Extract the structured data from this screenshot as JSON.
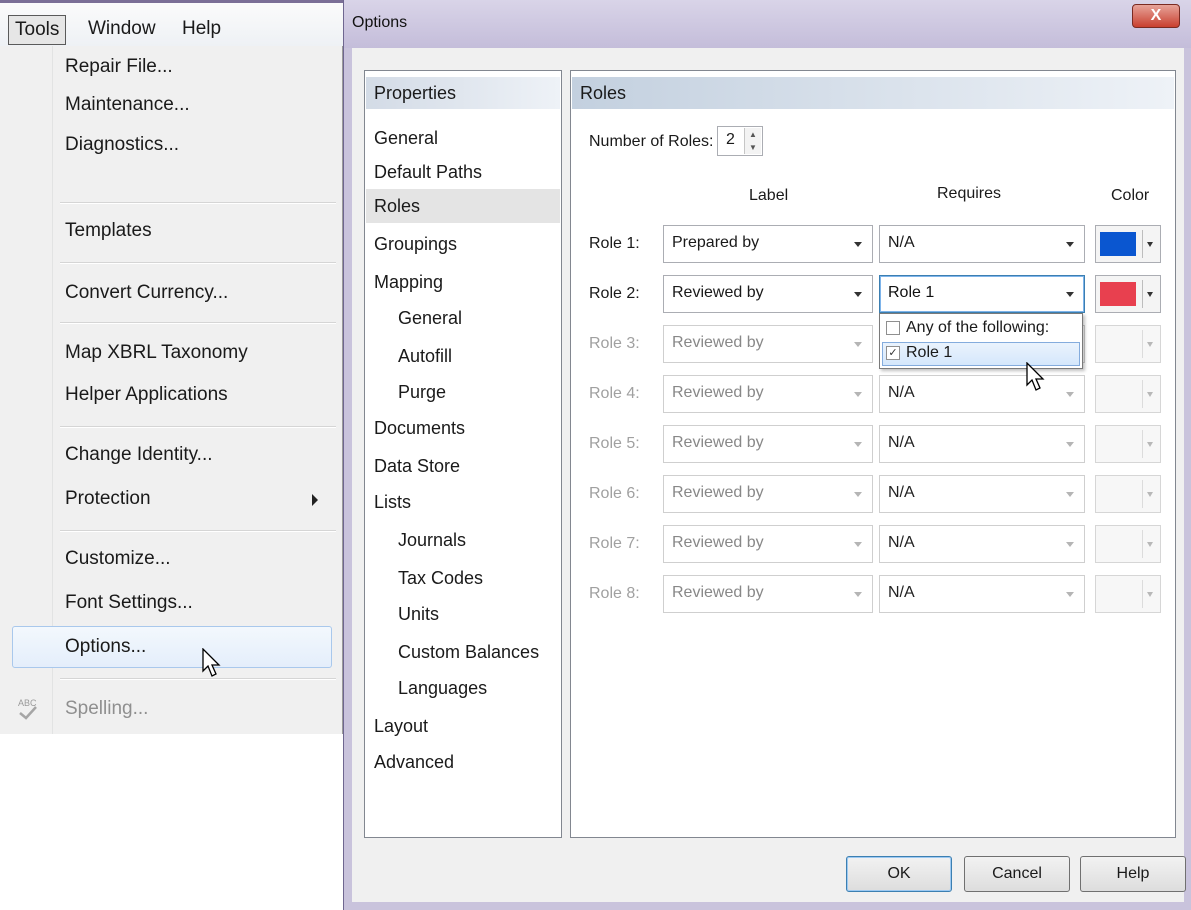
{
  "menubar": {
    "tools": "Tools",
    "window": "Window",
    "help": "Help"
  },
  "tools_menu": {
    "items": [
      {
        "label": "Repair File..."
      },
      {
        "label": "Maintenance..."
      },
      {
        "label": "Diagnostics..."
      },
      {
        "label": "Templates"
      },
      {
        "label": "Convert Currency..."
      },
      {
        "label": "Map XBRL Taxonomy"
      },
      {
        "label": "Helper Applications"
      },
      {
        "label": "Change Identity..."
      },
      {
        "label": "Protection"
      },
      {
        "label": "Customize..."
      },
      {
        "label": "Font Settings..."
      },
      {
        "label": "Options..."
      },
      {
        "label": "Spelling..."
      }
    ],
    "spelling_icon_text": "ABC"
  },
  "dialog": {
    "title": "Options",
    "close_label": "X",
    "nav_header": "Properties",
    "nav_items": [
      "General",
      "Default Paths",
      "Roles",
      "Groupings",
      "Mapping",
      "General",
      "Autofill",
      "Purge",
      "Documents",
      "Data Store",
      "Lists",
      "Journals",
      "Tax Codes",
      "Units",
      "Custom Balances",
      "Languages",
      "Layout",
      "Advanced"
    ],
    "panel_header": "Roles",
    "number_of_roles_label": "Number of Roles:",
    "number_of_roles_value": "2",
    "columns": {
      "label": "Label",
      "requires": "Requires",
      "color": "Color"
    },
    "roles": [
      {
        "name": "Role 1:",
        "label": "Prepared by",
        "requires": "N/A",
        "color": "#0a56d0"
      },
      {
        "name": "Role 2:",
        "label": "Reviewed by",
        "requires": "Role 1",
        "color": "#e8404f"
      },
      {
        "name": "Role 3:",
        "label": "Reviewed by",
        "requires": "",
        "color": ""
      },
      {
        "name": "Role 4:",
        "label": "Reviewed by",
        "requires": "N/A",
        "color": ""
      },
      {
        "name": "Role 5:",
        "label": "Reviewed by",
        "requires": "N/A",
        "color": ""
      },
      {
        "name": "Role 6:",
        "label": "Reviewed by",
        "requires": "N/A",
        "color": ""
      },
      {
        "name": "Role 7:",
        "label": "Reviewed by",
        "requires": "N/A",
        "color": ""
      },
      {
        "name": "Role 8:",
        "label": "Reviewed by",
        "requires": "N/A",
        "color": ""
      }
    ],
    "requires_popup": {
      "options": [
        {
          "label": "Any of the following:",
          "checked": false
        },
        {
          "label": "Role 1",
          "checked": true
        }
      ]
    },
    "buttons": {
      "ok": "OK",
      "cancel": "Cancel",
      "help": "Help"
    }
  }
}
